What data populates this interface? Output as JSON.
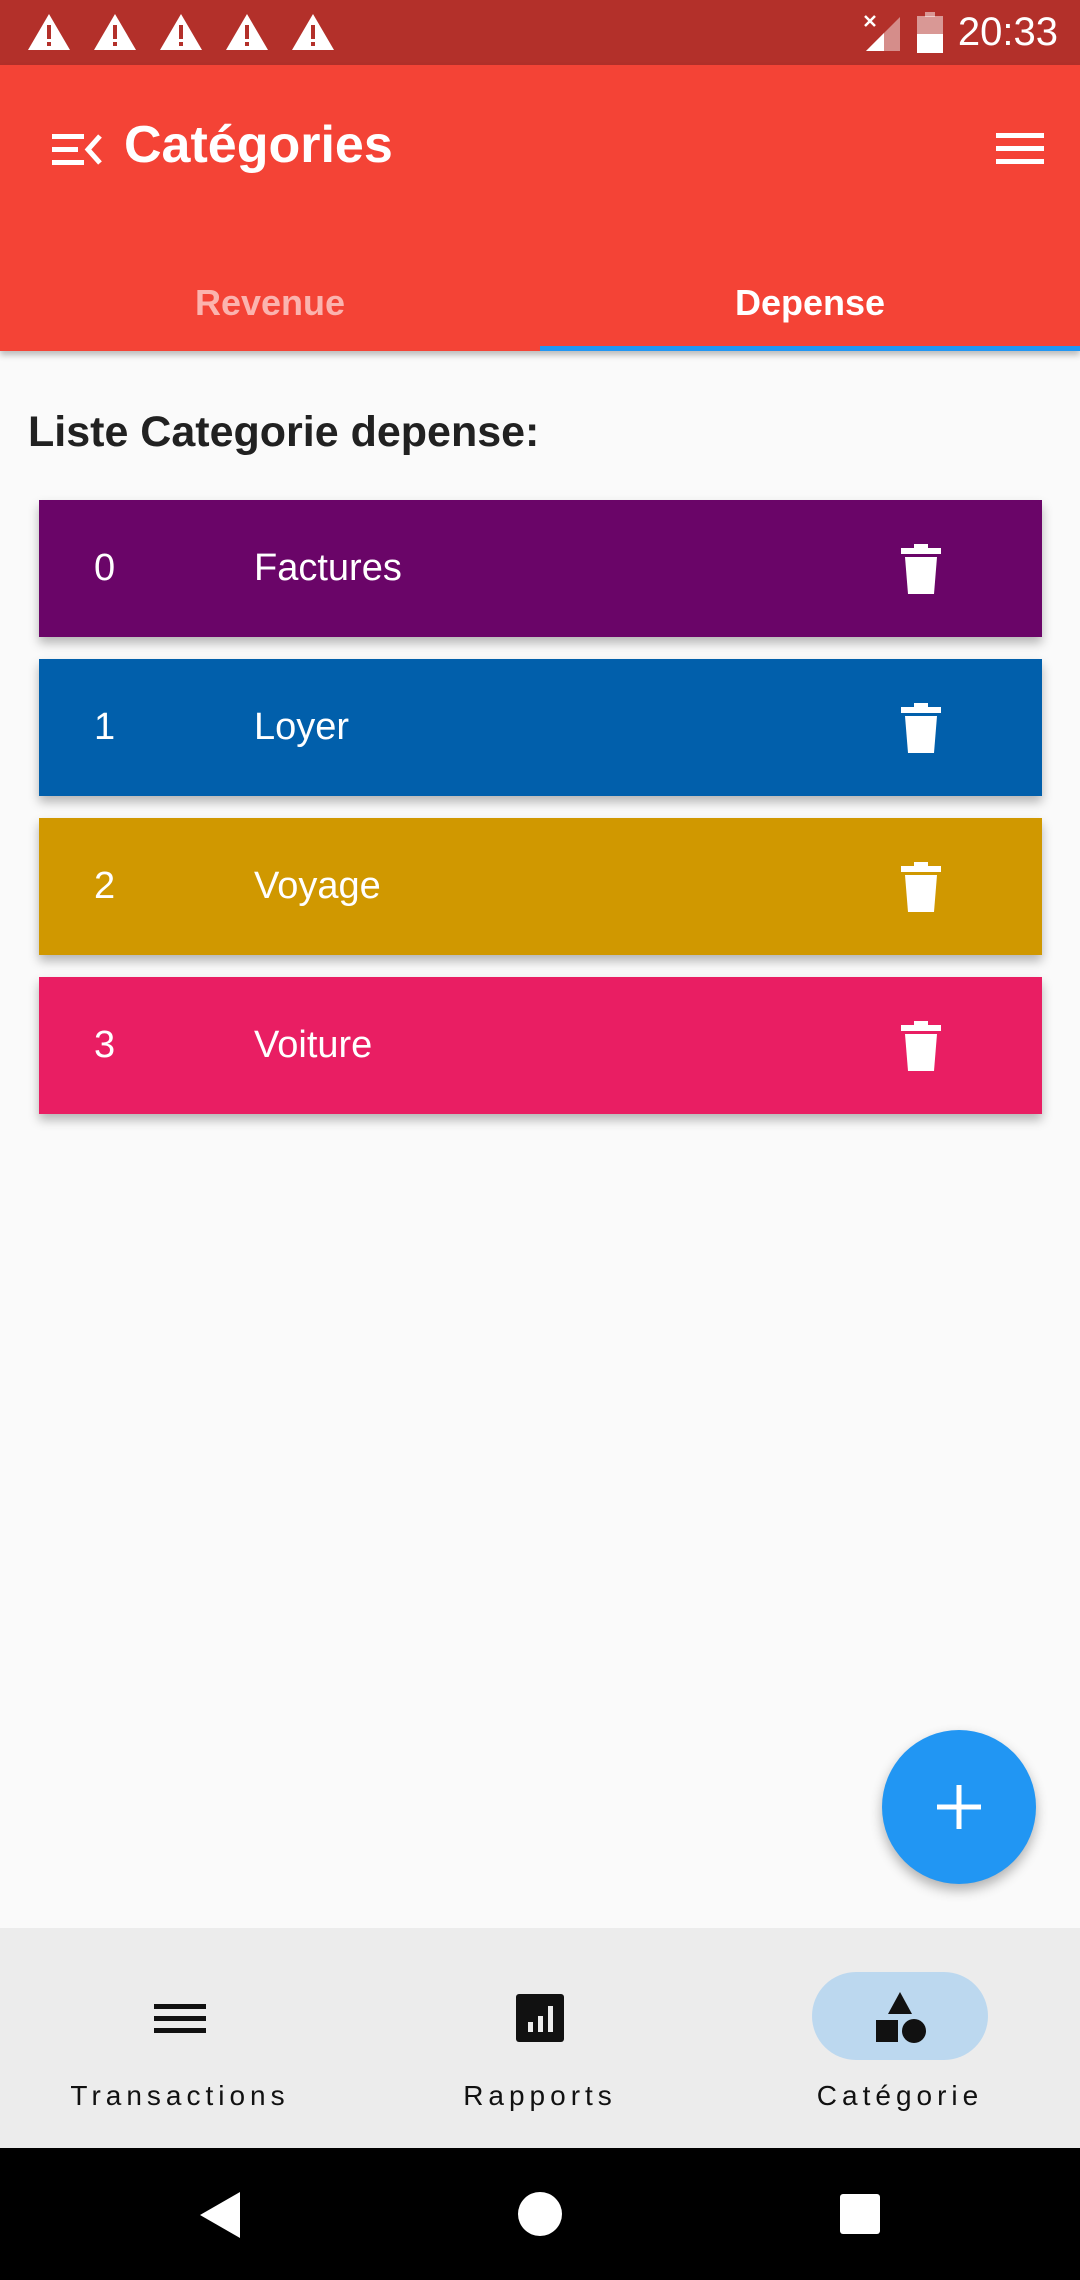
{
  "status_bar": {
    "time": "20:33",
    "warning_count": 5
  },
  "app_bar": {
    "title": "Catégories"
  },
  "tabs": [
    {
      "label": "Revenue",
      "selected": false
    },
    {
      "label": "Depense",
      "selected": true
    }
  ],
  "section_title": "Liste Categorie depense:",
  "categories": [
    {
      "index": "0",
      "name": "Factures",
      "color": "#6a0568"
    },
    {
      "index": "1",
      "name": "Loyer",
      "color": "#015fab"
    },
    {
      "index": "2",
      "name": "Voyage",
      "color": "#d09800"
    },
    {
      "index": "3",
      "name": "Voiture",
      "color": "#e91e63"
    }
  ],
  "fab": {
    "icon": "plus-icon"
  },
  "bottom_nav": {
    "items": [
      {
        "label": "Transactions",
        "icon": "list-icon",
        "selected": false
      },
      {
        "label": "Rapports",
        "icon": "bar-chart-icon",
        "selected": false
      },
      {
        "label": "Catégorie",
        "icon": "category-shapes-icon",
        "selected": true
      }
    ]
  },
  "colors": {
    "primary": "#f44336",
    "status_bar": "#b3302a",
    "accent": "#2196f3",
    "nav_pill": "#bcd8ef"
  }
}
